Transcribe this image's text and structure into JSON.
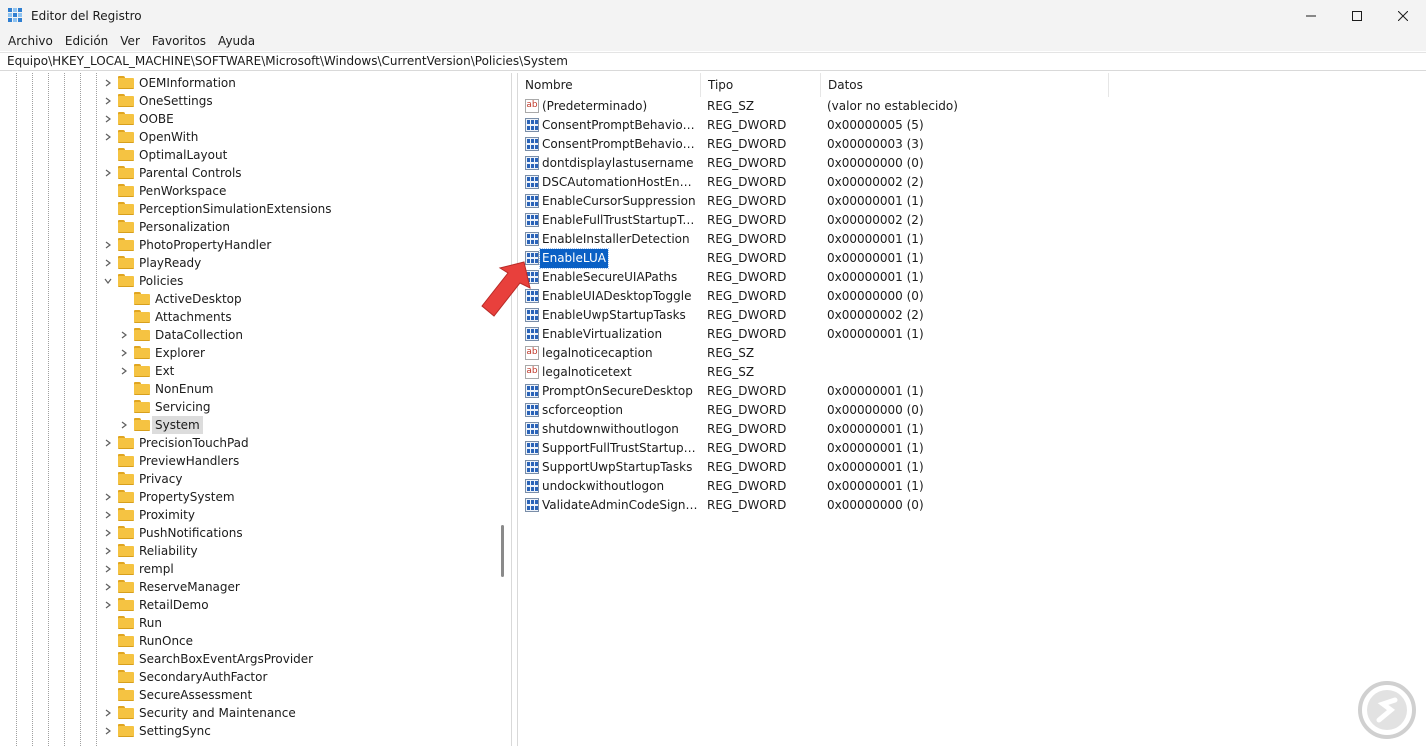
{
  "window": {
    "title": "Editor del Registro",
    "controls": [
      "minimize",
      "maximize",
      "close"
    ]
  },
  "menu": [
    "Archivo",
    "Edición",
    "Ver",
    "Favoritos",
    "Ayuda"
  ],
  "address": "Equipo\\HKEY_LOCAL_MACHINE\\SOFTWARE\\Microsoft\\Windows\\CurrentVersion\\Policies\\System",
  "tree": {
    "items": [
      {
        "label": "OEMInformation",
        "level": 0,
        "chevron": "right"
      },
      {
        "label": "OneSettings",
        "level": 0,
        "chevron": "right"
      },
      {
        "label": "OOBE",
        "level": 0,
        "chevron": "right"
      },
      {
        "label": "OpenWith",
        "level": 0,
        "chevron": "right"
      },
      {
        "label": "OptimalLayout",
        "level": 0,
        "chevron": "none"
      },
      {
        "label": "Parental Controls",
        "level": 0,
        "chevron": "right"
      },
      {
        "label": "PenWorkspace",
        "level": 0,
        "chevron": "none"
      },
      {
        "label": "PerceptionSimulationExtensions",
        "level": 0,
        "chevron": "none"
      },
      {
        "label": "Personalization",
        "level": 0,
        "chevron": "none"
      },
      {
        "label": "PhotoPropertyHandler",
        "level": 0,
        "chevron": "right"
      },
      {
        "label": "PlayReady",
        "level": 0,
        "chevron": "right"
      },
      {
        "label": "Policies",
        "level": 0,
        "chevron": "down"
      },
      {
        "label": "ActiveDesktop",
        "level": 1,
        "chevron": "none"
      },
      {
        "label": "Attachments",
        "level": 1,
        "chevron": "none"
      },
      {
        "label": "DataCollection",
        "level": 1,
        "chevron": "right"
      },
      {
        "label": "Explorer",
        "level": 1,
        "chevron": "right"
      },
      {
        "label": "Ext",
        "level": 1,
        "chevron": "right"
      },
      {
        "label": "NonEnum",
        "level": 1,
        "chevron": "none"
      },
      {
        "label": "Servicing",
        "level": 1,
        "chevron": "none"
      },
      {
        "label": "System",
        "level": 1,
        "chevron": "right",
        "selected": true
      },
      {
        "label": "PrecisionTouchPad",
        "level": 0,
        "chevron": "right"
      },
      {
        "label": "PreviewHandlers",
        "level": 0,
        "chevron": "none"
      },
      {
        "label": "Privacy",
        "level": 0,
        "chevron": "none"
      },
      {
        "label": "PropertySystem",
        "level": 0,
        "chevron": "right"
      },
      {
        "label": "Proximity",
        "level": 0,
        "chevron": "right"
      },
      {
        "label": "PushNotifications",
        "level": 0,
        "chevron": "right"
      },
      {
        "label": "Reliability",
        "level": 0,
        "chevron": "right"
      },
      {
        "label": "rempl",
        "level": 0,
        "chevron": "right"
      },
      {
        "label": "ReserveManager",
        "level": 0,
        "chevron": "right"
      },
      {
        "label": "RetailDemo",
        "level": 0,
        "chevron": "right"
      },
      {
        "label": "Run",
        "level": 0,
        "chevron": "none"
      },
      {
        "label": "RunOnce",
        "level": 0,
        "chevron": "none"
      },
      {
        "label": "SearchBoxEventArgsProvider",
        "level": 0,
        "chevron": "none"
      },
      {
        "label": "SecondaryAuthFactor",
        "level": 0,
        "chevron": "none"
      },
      {
        "label": "SecureAssessment",
        "level": 0,
        "chevron": "none"
      },
      {
        "label": "Security and Maintenance",
        "level": 0,
        "chevron": "right"
      },
      {
        "label": "SettingSync",
        "level": 0,
        "chevron": "right"
      }
    ]
  },
  "columns": [
    "Nombre",
    "Tipo",
    "Datos"
  ],
  "values": [
    {
      "name": "(Predeterminado)",
      "type": "REG_SZ",
      "data": "(valor no establecido)",
      "icon": "string-value-icon"
    },
    {
      "name": "ConsentPromptBehaviorAd...",
      "type": "REG_DWORD",
      "data": "0x00000005 (5)",
      "icon": "dword-value-icon"
    },
    {
      "name": "ConsentPromptBehaviorUser",
      "type": "REG_DWORD",
      "data": "0x00000003 (3)",
      "icon": "dword-value-icon"
    },
    {
      "name": "dontdisplaylastusername",
      "type": "REG_DWORD",
      "data": "0x00000000 (0)",
      "icon": "dword-value-icon"
    },
    {
      "name": "DSCAutomationHostEnabled",
      "type": "REG_DWORD",
      "data": "0x00000002 (2)",
      "icon": "dword-value-icon"
    },
    {
      "name": "EnableCursorSuppression",
      "type": "REG_DWORD",
      "data": "0x00000001 (1)",
      "icon": "dword-value-icon"
    },
    {
      "name": "EnableFullTrustStartupTasks",
      "type": "REG_DWORD",
      "data": "0x00000002 (2)",
      "icon": "dword-value-icon"
    },
    {
      "name": "EnableInstallerDetection",
      "type": "REG_DWORD",
      "data": "0x00000001 (1)",
      "icon": "dword-value-icon"
    },
    {
      "name": "EnableLUA",
      "type": "REG_DWORD",
      "data": "0x00000001 (1)",
      "icon": "dword-value-icon",
      "selected": true
    },
    {
      "name": "EnableSecureUIAPaths",
      "type": "REG_DWORD",
      "data": "0x00000001 (1)",
      "icon": "dword-value-icon"
    },
    {
      "name": "EnableUIADesktopToggle",
      "type": "REG_DWORD",
      "data": "0x00000000 (0)",
      "icon": "dword-value-icon"
    },
    {
      "name": "EnableUwpStartupTasks",
      "type": "REG_DWORD",
      "data": "0x00000002 (2)",
      "icon": "dword-value-icon"
    },
    {
      "name": "EnableVirtualization",
      "type": "REG_DWORD",
      "data": "0x00000001 (1)",
      "icon": "dword-value-icon"
    },
    {
      "name": "legalnoticecaption",
      "type": "REG_SZ",
      "data": "",
      "icon": "string-value-icon"
    },
    {
      "name": "legalnoticetext",
      "type": "REG_SZ",
      "data": "",
      "icon": "string-value-icon"
    },
    {
      "name": "PromptOnSecureDesktop",
      "type": "REG_DWORD",
      "data": "0x00000001 (1)",
      "icon": "dword-value-icon"
    },
    {
      "name": "scforceoption",
      "type": "REG_DWORD",
      "data": "0x00000000 (0)",
      "icon": "dword-value-icon"
    },
    {
      "name": "shutdownwithoutlogon",
      "type": "REG_DWORD",
      "data": "0x00000001 (1)",
      "icon": "dword-value-icon"
    },
    {
      "name": "SupportFullTrustStartupTasks",
      "type": "REG_DWORD",
      "data": "0x00000001 (1)",
      "icon": "dword-value-icon"
    },
    {
      "name": "SupportUwpStartupTasks",
      "type": "REG_DWORD",
      "data": "0x00000001 (1)",
      "icon": "dword-value-icon"
    },
    {
      "name": "undockwithoutlogon",
      "type": "REG_DWORD",
      "data": "0x00000001 (1)",
      "icon": "dword-value-icon"
    },
    {
      "name": "ValidateAdminCodeSignatur...",
      "type": "REG_DWORD",
      "data": "0x00000000 (0)",
      "icon": "dword-value-icon"
    }
  ],
  "colors": {
    "selection": "#0a60c5",
    "tree_selection": "#dcdcdc",
    "folder": "#f5c342",
    "arrow": "#e8403c"
  }
}
